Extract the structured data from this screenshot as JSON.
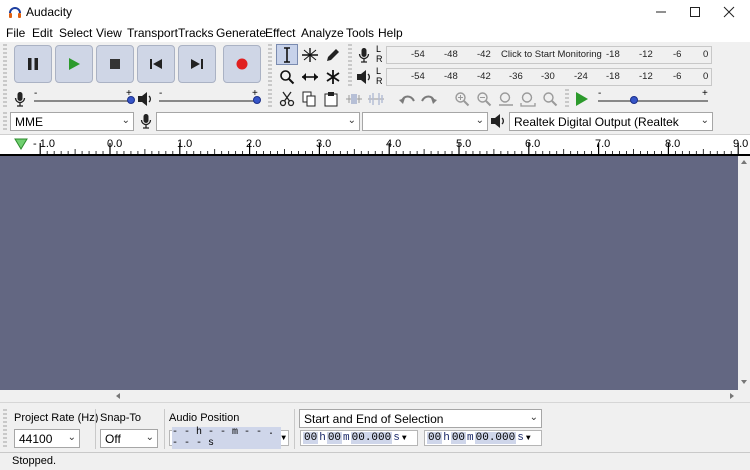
{
  "window": {
    "title": "Audacity"
  },
  "menu": [
    "File",
    "Edit",
    "Select",
    "View",
    "Transport",
    "Tracks",
    "Generate",
    "Effect",
    "Analyze",
    "Tools",
    "Help"
  ],
  "meters": {
    "record_prompt": "Click to Start Monitoring",
    "record_ticks": [
      "-54",
      "-48",
      "-42",
      "-18",
      "-12",
      "-6",
      "0"
    ],
    "playback_ticks": [
      "-54",
      "-48",
      "-42",
      "-36",
      "-30",
      "-24",
      "-18",
      "-12",
      "-6",
      "0"
    ],
    "channel_l": "L",
    "channel_r": "R"
  },
  "device": {
    "host": "MME",
    "recording_device": "",
    "recording_channels": "",
    "playback_device": "Realtek Digital Output (Realtek"
  },
  "sliders": {
    "minus": "-",
    "plus": "+"
  },
  "timeline": {
    "labels": [
      "- 1.0",
      "0.0",
      "1.0",
      "2.0",
      "3.0",
      "4.0",
      "5.0",
      "6.0",
      "7.0",
      "8.0",
      "9.0"
    ]
  },
  "selection_bar": {
    "project_rate_label": "Project Rate (Hz)",
    "project_rate_value": "44100",
    "snap_to_label": "Snap-To",
    "snap_to_value": "Off",
    "audio_position_label": "Audio Position",
    "audio_position_value": "- - h - - m - - . - - - s",
    "selection_mode": "Start and End of Selection",
    "start_time": {
      "h": "00",
      "m": "00",
      "s": "00.000"
    },
    "end_time": {
      "h": "00",
      "m": "00",
      "s": "00.000"
    }
  },
  "status": {
    "text": "Stopped."
  },
  "colors": {
    "track_bg": "#636782",
    "accent_blue": "#3655c8",
    "play_green": "#2c9a2c",
    "record_red": "#e02020"
  }
}
